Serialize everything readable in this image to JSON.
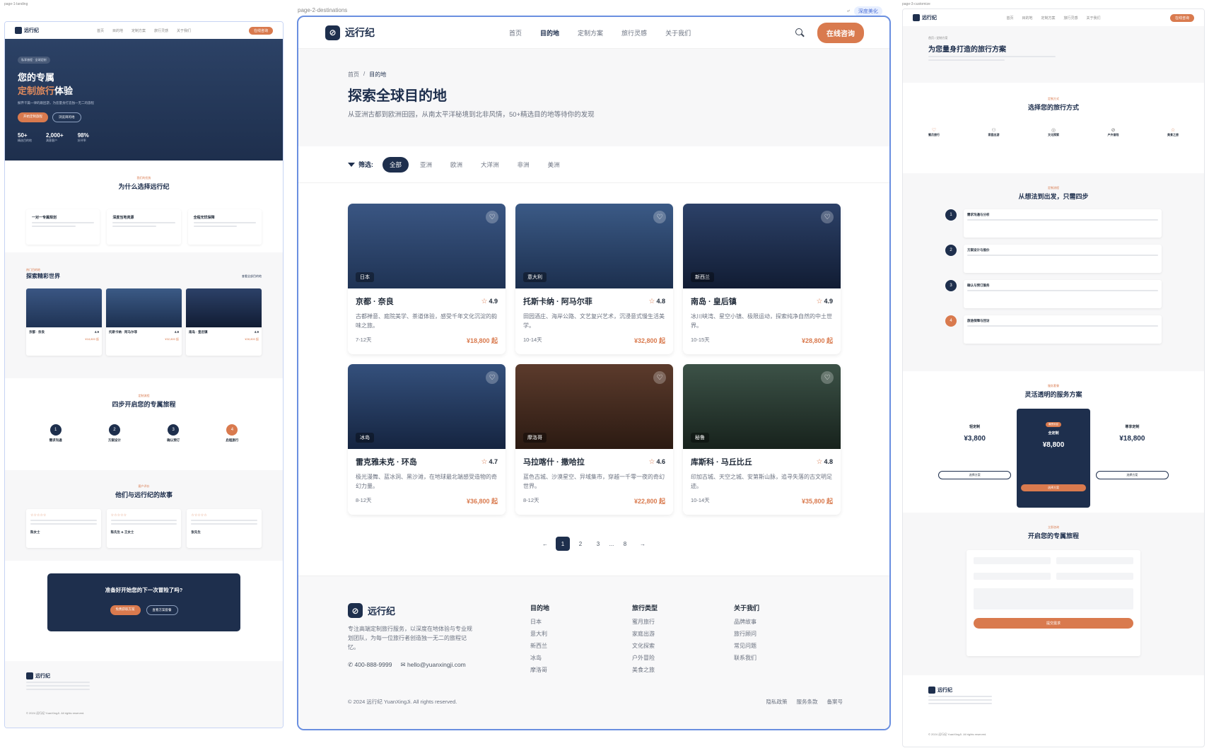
{
  "left_page": {
    "label": "page-1-landing",
    "nav": {
      "links": [
        "首页",
        "目的地",
        "定制方案",
        "旅行灵感",
        "关于我们"
      ],
      "cta": "在线咨询"
    },
    "hero": {
      "badge": "私享旅程 · 全球定制",
      "title_line1": "您的专属",
      "title_accent": "定制旅行",
      "title_tail": "体验",
      "subtitle": "摒弃千篇一律的跟团游，为您量身打造独一无二的旅程",
      "btn_primary": "开始定制旅程",
      "btn_secondary": "浏览目的地",
      "stats": [
        {
          "value": "50+",
          "label": "精选目的地"
        },
        {
          "value": "2,000+",
          "label": "满意客户"
        },
        {
          "value": "98%",
          "label": "好评率"
        }
      ]
    },
    "why": {
      "tag": "我们的优势",
      "title": "为什么选择远行纪",
      "items": [
        {
          "title": "一对一专属规划"
        },
        {
          "title": "深度当地资源"
        },
        {
          "title": "全程无忧保障"
        }
      ]
    },
    "explore": {
      "tag": "热门目的地",
      "title": "探索精彩世界",
      "link": "查看全部目的地",
      "cards": [
        {
          "tag": "日本",
          "title": "京都 · 奈良",
          "rating": "4.9",
          "price": "¥18,800 起"
        },
        {
          "tag": "意大利",
          "title": "托斯卡纳 · 阿马尔菲",
          "rating": "4.8",
          "price": "¥32,800 起"
        },
        {
          "tag": "新西兰",
          "title": "南岛 · 皇后镇",
          "rating": "4.9",
          "price": "¥28,800 起"
        }
      ]
    },
    "steps": {
      "tag": "定制流程",
      "title": "四步开启您的专属旅程",
      "items": [
        "需求沟通",
        "方案设计",
        "确认预订",
        "启程旅行"
      ]
    },
    "stories": {
      "tag": "客户评价",
      "title": "他们与远行纪的故事",
      "people": [
        "陈女士",
        "陈先生 & 王女士",
        "张先生"
      ]
    },
    "cta": {
      "title": "准备好开始您的下一次冒险了吗?",
      "btn1": "免费获取方案",
      "btn2": "查看方案套餐"
    },
    "footer": {
      "copyright": "© 2024 远行纪 YuanXingJi. All rights reserved."
    }
  },
  "main": {
    "label": "page-2-destinations",
    "tools_pill": "深度美化",
    "nav": {
      "logo": "远行纪",
      "links": [
        "首页",
        "目的地",
        "定制方案",
        "旅行灵感",
        "关于我们"
      ],
      "active_index": 1,
      "cta": "在线咨询"
    },
    "hero": {
      "crumb_home": "首页",
      "crumb_sep": "/",
      "crumb_current": "目的地",
      "title": "探索全球目的地",
      "subtitle": "从亚洲古都到欧洲田园，从南太平洋秘境到北非风情，50+精选目的地等待你的发现"
    },
    "filters": {
      "label": "筛选:",
      "chips": [
        "全部",
        "亚洲",
        "欧洲",
        "大洋洲",
        "非洲",
        "美洲"
      ],
      "active_index": 0
    },
    "cards": [
      {
        "tag": "日本",
        "title": "京都 · 奈良",
        "rating": "4.9",
        "desc": "古都禅意、庭院美学、茶道体验，感受千年文化沉淀的韵味之旅。",
        "days": "7-12天",
        "price": "¥18,800 起",
        "img_top": "#3a5683",
        "img_bottom": "#1f3354"
      },
      {
        "tag": "意大利",
        "title": "托斯卡纳 · 阿马尔菲",
        "rating": "4.8",
        "desc": "田园酒庄、海岸公路、文艺复兴艺术，沉浸意式慢生活美学。",
        "days": "10-14天",
        "price": "¥32,800 起",
        "img_top": "#3b5a86",
        "img_bottom": "#1c2f4e"
      },
      {
        "tag": "新西兰",
        "title": "南岛 · 皇后镇",
        "rating": "4.9",
        "desc": "冰川峡湾、星空小镇、极限运动，探索纯净自然的中土世界。",
        "days": "10-15天",
        "price": "¥28,800 起",
        "img_top": "#2c4168",
        "img_bottom": "#111c33"
      },
      {
        "tag": "冰岛",
        "title": "雷克雅未克 · 环岛",
        "rating": "4.7",
        "desc": "极光漫舞、蓝冰洞、黑沙滩，在地球最北端感受造物的奇幻力量。",
        "days": "8-12天",
        "price": "¥36,800 起",
        "img_top": "#34507c",
        "img_bottom": "#152440"
      },
      {
        "tag": "摩洛哥",
        "title": "马拉喀什 · 撒哈拉",
        "rating": "4.6",
        "desc": "蓝色古城、沙漠星空、异域集市，穿越一千零一夜的奇幻世界。",
        "days": "8-12天",
        "price": "¥22,800 起",
        "img_top": "#5c3b2c",
        "img_bottom": "#2b1a12"
      },
      {
        "tag": "秘鲁",
        "title": "库斯科 · 马丘比丘",
        "rating": "4.8",
        "desc": "印加古城、天空之城、安第斯山脉，追寻失落的古文明足迹。",
        "days": "10-14天",
        "price": "¥35,800 起",
        "img_top": "#3c5247",
        "img_bottom": "#17221c"
      }
    ],
    "pager": {
      "prev": "←",
      "pages": [
        "1",
        "2",
        "3",
        "...",
        "8"
      ],
      "next": "→",
      "active": "1"
    },
    "footer": {
      "logo": "远行纪",
      "desc": "专注高端定制旅行服务，以深度在地体验与专业规划团队，为每一位旅行者创造独一无二的旅程记忆。",
      "phone": "400-888-9999",
      "email": "hello@yuanxingji.com",
      "columns": [
        {
          "title": "目的地",
          "items": [
            "日本",
            "意大利",
            "新西兰",
            "冰岛",
            "摩洛哥"
          ]
        },
        {
          "title": "旅行类型",
          "items": [
            "蜜月旅行",
            "家庭出游",
            "文化探索",
            "户外冒险",
            "美食之旅"
          ]
        },
        {
          "title": "关于我们",
          "items": [
            "品牌故事",
            "旅行顾问",
            "常见问题",
            "联系我们"
          ]
        }
      ],
      "copyright": "© 2024 远行纪 YuanXingJi. All rights reserved.",
      "legal": [
        "隐私政策",
        "服务条款",
        "备案号"
      ]
    }
  },
  "right_page": {
    "label": "page-3-customize",
    "crumb": "首页 / 定制方案",
    "title": "为您量身打造的旅行方案",
    "ways": {
      "tag": "定制方式",
      "title": "选择您的旅行方式",
      "items": [
        "蜜月旅行",
        "家庭出游",
        "文化探索",
        "户外冒险",
        "美食之旅"
      ]
    },
    "process": {
      "tag": "定制流程",
      "title": "从想法到出发，只需四步",
      "steps": [
        "需求沟通与分析",
        "方案设计与报价",
        "确认与预订服务",
        "旅途保障与回访"
      ]
    },
    "pricing": {
      "tag": "服务套餐",
      "title": "灵活透明的服务方案",
      "plans": [
        {
          "name": "轻定制",
          "price": "¥3,800",
          "btn": "选择方案"
        },
        {
          "name": "全定制",
          "price": "¥8,800",
          "btn": "选择方案",
          "badge": "最受欢迎"
        },
        {
          "name": "尊享定制",
          "price": "¥18,800",
          "btn": "选择方案"
        }
      ]
    },
    "form": {
      "tag": "立即咨询",
      "title": "开启您的专属旅程",
      "submit": "提交需求"
    }
  },
  "colors": {
    "navy": "#1e2f4d",
    "accent": "#d97a4e",
    "frame": "#6a8fe0"
  }
}
